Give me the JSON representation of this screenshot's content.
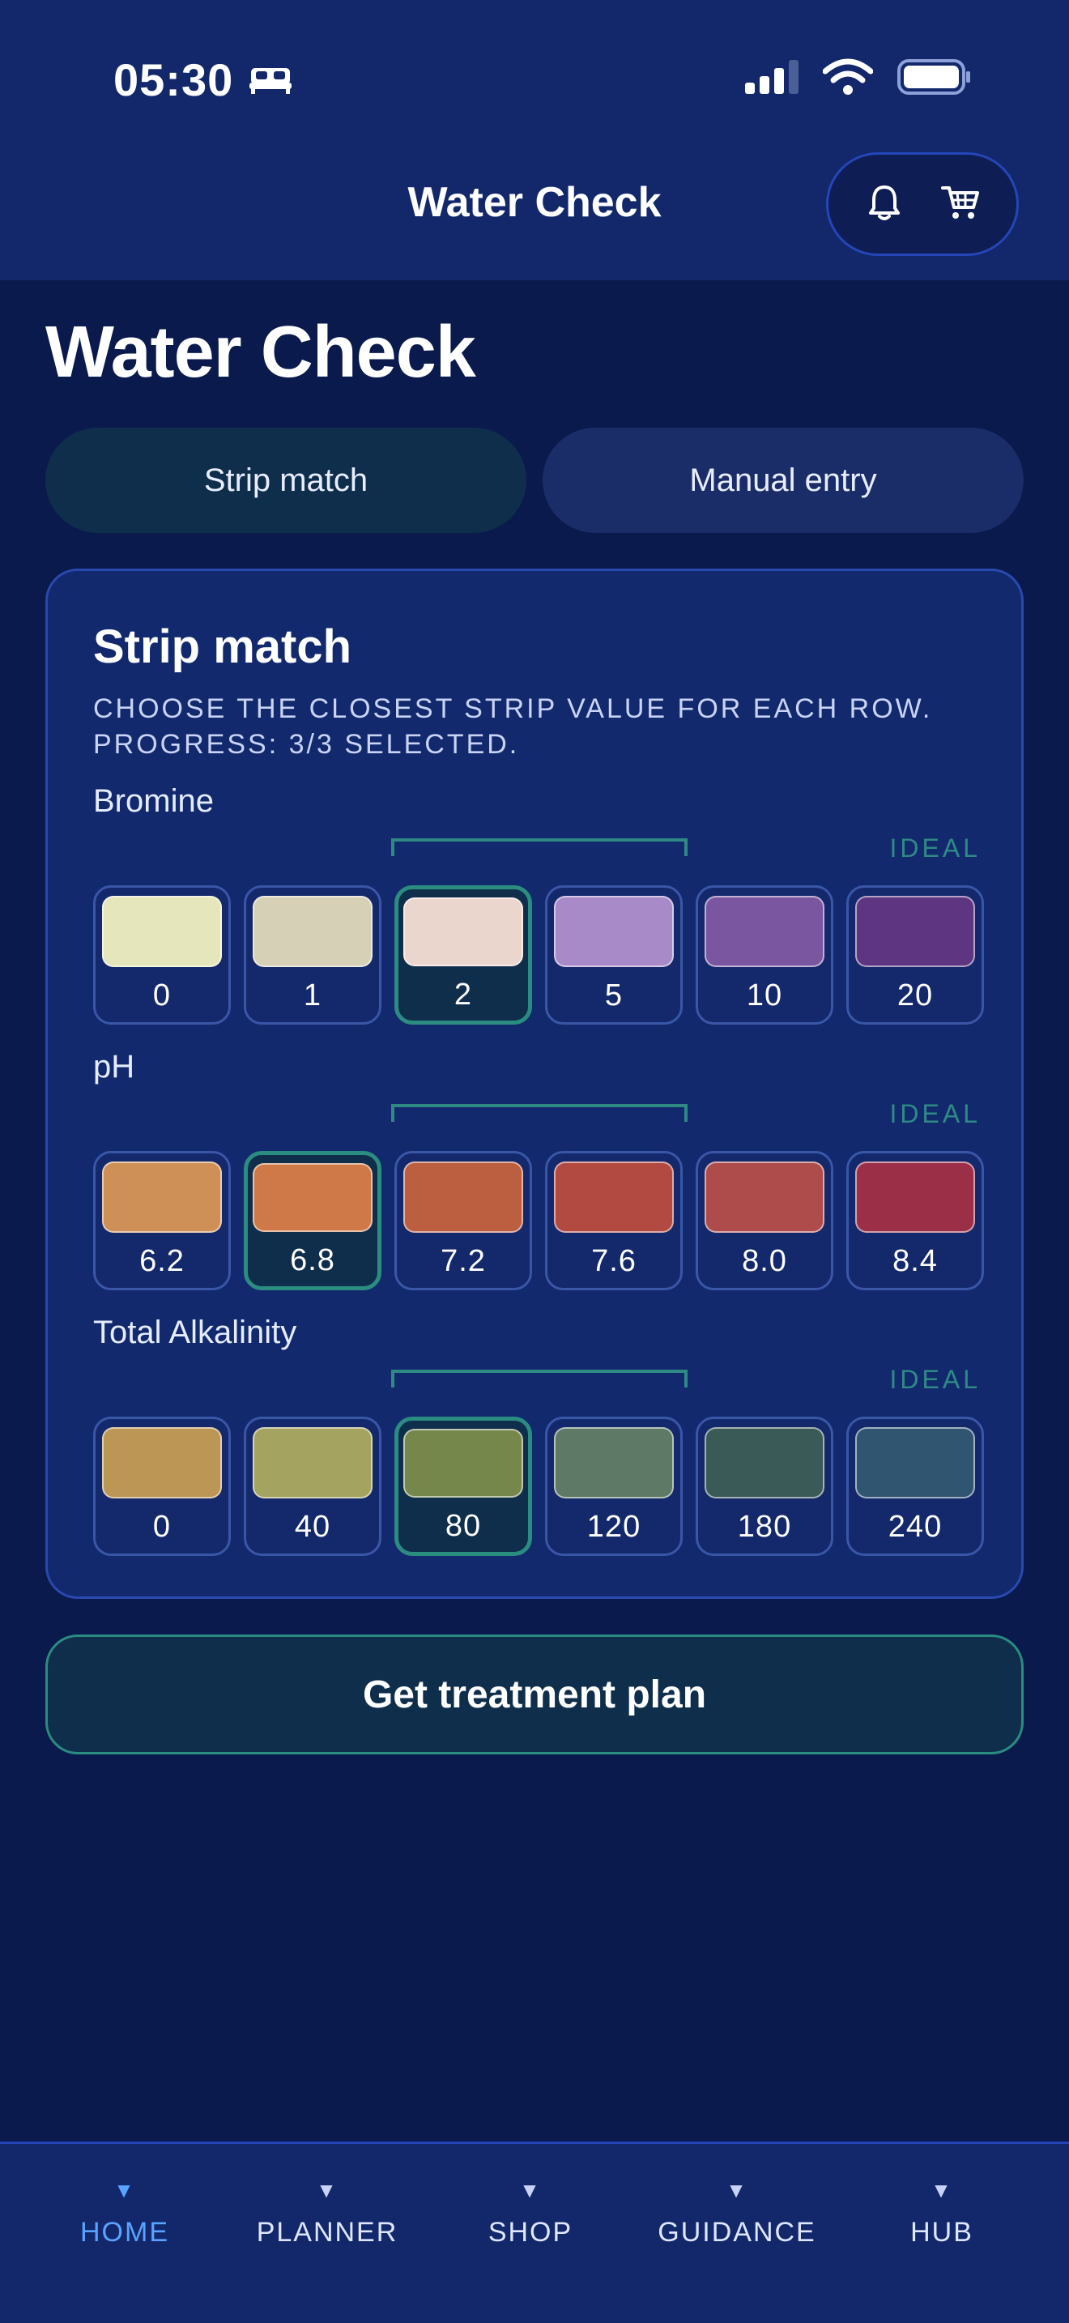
{
  "status_bar": {
    "time": "05:30"
  },
  "header": {
    "title": "Water Check"
  },
  "page": {
    "title": "Water Check"
  },
  "tabs": [
    {
      "label": "Strip match",
      "active": true
    },
    {
      "label": "Manual entry",
      "active": false
    }
  ],
  "card": {
    "title": "Strip match",
    "instruction": "CHOOSE THE CLOSEST STRIP VALUE FOR EACH ROW. PROGRESS: 3/3 SELECTED.",
    "ideal_label": "IDEAL",
    "params": [
      {
        "label": "Bromine",
        "selected_index": 2,
        "swatches": [
          {
            "value": "0",
            "color": "#e6e6bc"
          },
          {
            "value": "1",
            "color": "#d6d0b6"
          },
          {
            "value": "2",
            "color": "#ead6cc"
          },
          {
            "value": "5",
            "color": "#a88ac8"
          },
          {
            "value": "10",
            "color": "#7a55a0"
          },
          {
            "value": "20",
            "color": "#5e3580"
          }
        ]
      },
      {
        "label": "pH",
        "selected_index": 1,
        "swatches": [
          {
            "value": "6.2",
            "color": "#cf9058"
          },
          {
            "value": "6.8",
            "color": "#cf7848"
          },
          {
            "value": "7.2",
            "color": "#bc5e40"
          },
          {
            "value": "7.6",
            "color": "#b24a42"
          },
          {
            "value": "8.0",
            "color": "#ae4c4c"
          },
          {
            "value": "8.4",
            "color": "#9c2f48"
          }
        ]
      },
      {
        "label": "Total Alkalinity",
        "selected_index": 2,
        "swatches": [
          {
            "value": "0",
            "color": "#bc9655"
          },
          {
            "value": "40",
            "color": "#a4a35f"
          },
          {
            "value": "80",
            "color": "#76874c"
          },
          {
            "value": "120",
            "color": "#5e7a67"
          },
          {
            "value": "180",
            "color": "#3a5a58"
          },
          {
            "value": "240",
            "color": "#2f5570"
          }
        ]
      }
    ]
  },
  "cta": {
    "label": "Get treatment plan"
  },
  "bottom_nav": [
    {
      "label": "HOME",
      "active": true
    },
    {
      "label": "PLANNER",
      "active": false
    },
    {
      "label": "SHOP",
      "active": false
    },
    {
      "label": "GUIDANCE",
      "active": false
    },
    {
      "label": "HUB",
      "active": false
    }
  ],
  "icons": {
    "header_actions": [
      "bell-icon",
      "cart-icon"
    ],
    "status_bar": [
      "bed-icon",
      "signal-icon",
      "wifi-icon",
      "battery-icon"
    ]
  },
  "colors": {
    "background": "#0a1a4d",
    "bar": "#12286b",
    "accent": "#2b8c80",
    "nav_active": "#5aa2ff"
  }
}
